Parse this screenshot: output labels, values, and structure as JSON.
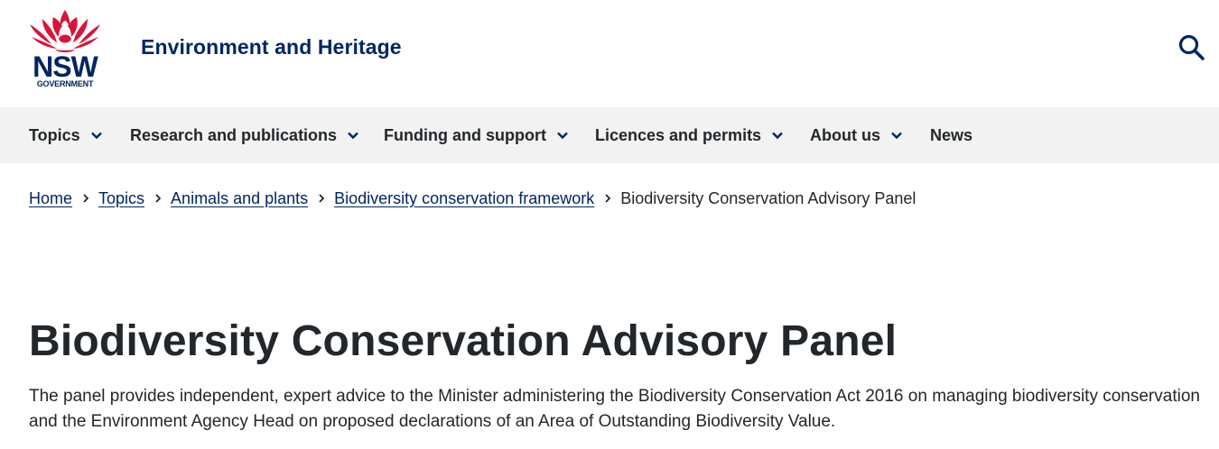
{
  "header": {
    "logo": {
      "wordmark": "NSW",
      "subtext": "GOVERNMENT",
      "icon": "waratah-icon",
      "color": "#002664",
      "petal_color": "#d7153a"
    },
    "site_title": "Environment and Heritage",
    "search_icon": "search-icon"
  },
  "nav": {
    "items": [
      {
        "label": "Topics",
        "has_dropdown": true
      },
      {
        "label": "Research and publications",
        "has_dropdown": true
      },
      {
        "label": "Funding and support",
        "has_dropdown": true
      },
      {
        "label": "Licences and permits",
        "has_dropdown": true
      },
      {
        "label": "About us",
        "has_dropdown": true
      },
      {
        "label": "News",
        "has_dropdown": false
      }
    ]
  },
  "breadcrumb": {
    "links": [
      "Home",
      "Topics",
      "Animals and plants",
      "Biodiversity conservation framework"
    ],
    "current": "Biodiversity Conservation Advisory Panel"
  },
  "main": {
    "title": "Biodiversity Conservation Advisory Panel",
    "intro": "The panel provides independent, expert advice to the Minister administering the Biodiversity Conservation Act 2016 on managing biodiversity conservation and the Environment Agency Head on proposed declarations of an Area of Outstanding Biodiversity Value."
  },
  "colors": {
    "brand_navy": "#002664",
    "brand_red": "#d7153a",
    "text": "#22272b",
    "nav_background": "#f2f2f2"
  }
}
